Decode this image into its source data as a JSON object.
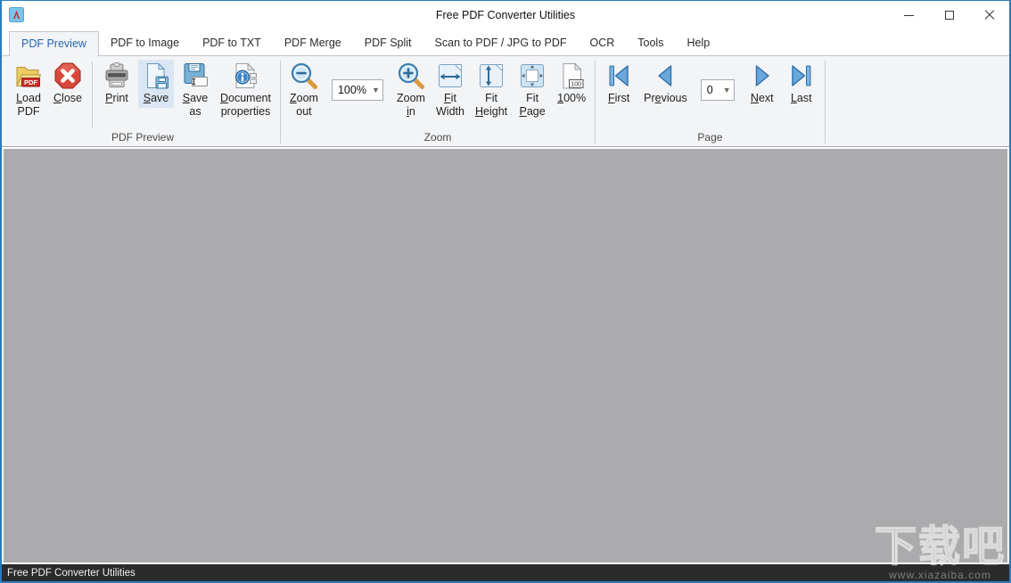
{
  "window": {
    "title": "Free PDF Converter Utilities",
    "controls": {
      "minimize": "minimize",
      "maximize": "maximize",
      "close": "close"
    }
  },
  "tabs": [
    {
      "label": "PDF Preview",
      "active": true
    },
    {
      "label": "PDF to Image",
      "active": false
    },
    {
      "label": "PDF to TXT",
      "active": false
    },
    {
      "label": "PDF Merge",
      "active": false
    },
    {
      "label": "PDF Split",
      "active": false
    },
    {
      "label": "Scan to PDF / JPG to PDF",
      "active": false
    },
    {
      "label": "OCR",
      "active": false
    },
    {
      "label": "Tools",
      "active": false
    },
    {
      "label": "Help",
      "active": false
    }
  ],
  "ribbon": {
    "groups": [
      {
        "label": "PDF Preview",
        "items": [
          {
            "type": "button",
            "name": "load-pdf-button",
            "icon": "folder-pdf",
            "lines": [
              {
                "text": "Load",
                "u": 0
              },
              {
                "text": "PDF",
                "u": null
              }
            ]
          },
          {
            "type": "button",
            "name": "close-button",
            "icon": "close-octagon",
            "lines": [
              {
                "text": "Close",
                "u": 0
              }
            ]
          },
          {
            "type": "separator"
          },
          {
            "type": "button",
            "name": "print-button",
            "icon": "printer",
            "lines": [
              {
                "text": "Print",
                "u": 0
              }
            ]
          },
          {
            "type": "button",
            "name": "save-button",
            "icon": "save-doc",
            "highlighted": true,
            "lines": [
              {
                "text": "Save",
                "u": 0
              }
            ]
          },
          {
            "type": "button",
            "name": "save-as-button",
            "icon": "save-as",
            "lines": [
              {
                "text": "Save",
                "u": 0
              },
              {
                "text": "as",
                "u": null
              }
            ]
          },
          {
            "type": "button",
            "name": "document-properties-button",
            "icon": "doc-info",
            "lines": [
              {
                "text": "Document",
                "u": 0
              },
              {
                "text": "properties",
                "u": null
              }
            ]
          }
        ]
      },
      {
        "label": "Zoom",
        "items": [
          {
            "type": "button",
            "name": "zoom-out-button",
            "icon": "magnifier-minus",
            "lines": [
              {
                "text": "Zoom",
                "u": 0
              },
              {
                "text": "out",
                "u": null
              }
            ]
          },
          {
            "type": "combobox",
            "name": "zoom-level-combo",
            "value": "100%",
            "width": 58
          },
          {
            "type": "button",
            "name": "zoom-in-button",
            "icon": "magnifier-plus",
            "lines": [
              {
                "text": "Zoom",
                "u": null
              },
              {
                "text": "in",
                "u": 0
              }
            ]
          },
          {
            "type": "button",
            "name": "fit-width-button",
            "icon": "fit-width",
            "lines": [
              {
                "text": "Fit",
                "u": 0
              },
              {
                "text": "Width",
                "u": null
              }
            ]
          },
          {
            "type": "button",
            "name": "fit-height-button",
            "icon": "fit-height",
            "lines": [
              {
                "text": "Fit",
                "u": null
              },
              {
                "text": "Height",
                "u": 0
              }
            ]
          },
          {
            "type": "button",
            "name": "fit-page-button",
            "icon": "fit-page",
            "lines": [
              {
                "text": "Fit",
                "u": null
              },
              {
                "text": "Page",
                "u": 0
              }
            ]
          },
          {
            "type": "button",
            "name": "zoom-100-button",
            "icon": "page-100",
            "lines": [
              {
                "text": "100%",
                "u": 0
              }
            ]
          }
        ]
      },
      {
        "label": "Page",
        "items": [
          {
            "type": "button",
            "name": "first-page-button",
            "icon": "nav-first",
            "lines": [
              {
                "text": "First",
                "u": 0
              }
            ]
          },
          {
            "type": "button",
            "name": "previous-page-button",
            "icon": "nav-previous",
            "lines": [
              {
                "text": "Previous",
                "u": 2
              }
            ]
          },
          {
            "type": "combobox",
            "name": "page-number-combo",
            "value": "0",
            "width": 38
          },
          {
            "type": "button",
            "name": "next-page-button",
            "icon": "nav-next",
            "lines": [
              {
                "text": "Next",
                "u": 0
              }
            ]
          },
          {
            "type": "button",
            "name": "last-page-button",
            "icon": "nav-last",
            "lines": [
              {
                "text": "Last",
                "u": 0
              }
            ]
          }
        ]
      }
    ]
  },
  "statusbar": {
    "text": "Free PDF Converter Utilities"
  },
  "watermark": {
    "text": "下载吧",
    "url": "www.xiazaiba.com"
  },
  "colors": {
    "accent_border": "#2b7bbf",
    "active_tab_text": "#2368ad",
    "ribbon_bg": "#f3f4f6",
    "button_highlight": "#dbe6f4",
    "content_bg": "#ababad",
    "statusbar_bg": "#2b2b2b"
  }
}
